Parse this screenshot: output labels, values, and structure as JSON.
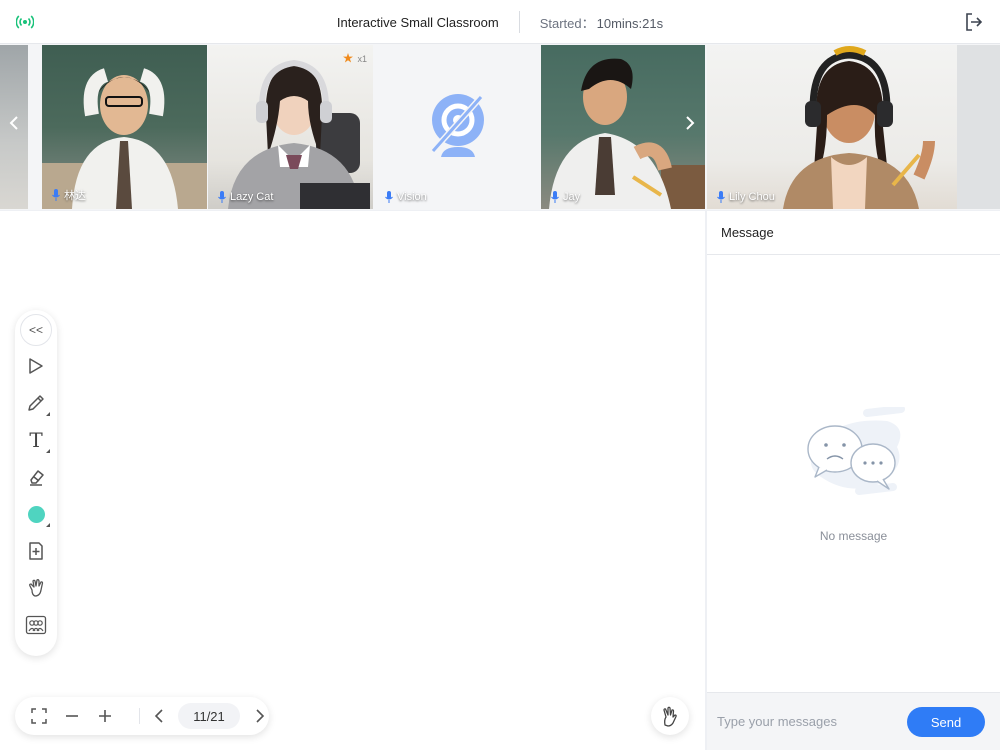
{
  "header": {
    "title": "Interactive Small Classroom",
    "started_label": "Started：",
    "started_time": "10mins:21s"
  },
  "participants": [
    {
      "name": "林达",
      "camera": "on"
    },
    {
      "name": "Lazy Cat",
      "camera": "on",
      "badge": "x1"
    },
    {
      "name": "Vision",
      "camera": "off"
    },
    {
      "name": "Jay",
      "camera": "on"
    },
    {
      "name": "Lily Chou",
      "camera": "on"
    }
  ],
  "toolbar": {
    "tools": [
      "collapse-icon",
      "select-icon",
      "pencil-icon",
      "text-icon",
      "eraser-icon",
      "color-icon",
      "add-page-icon",
      "hand-icon",
      "gallery-icon"
    ],
    "collapse_glyph": "<<",
    "text_glyph": "T",
    "active_color": "#4fd4c0"
  },
  "pager": {
    "current": 11,
    "total": 21,
    "display": "11/21"
  },
  "chat": {
    "title": "Message",
    "empty_text": "No message",
    "input_placeholder": "Type your messages",
    "send_label": "Send"
  },
  "colors": {
    "accent": "#2f7cf6",
    "signal": "#19c27a",
    "camera_off": "#6f9ff5"
  }
}
